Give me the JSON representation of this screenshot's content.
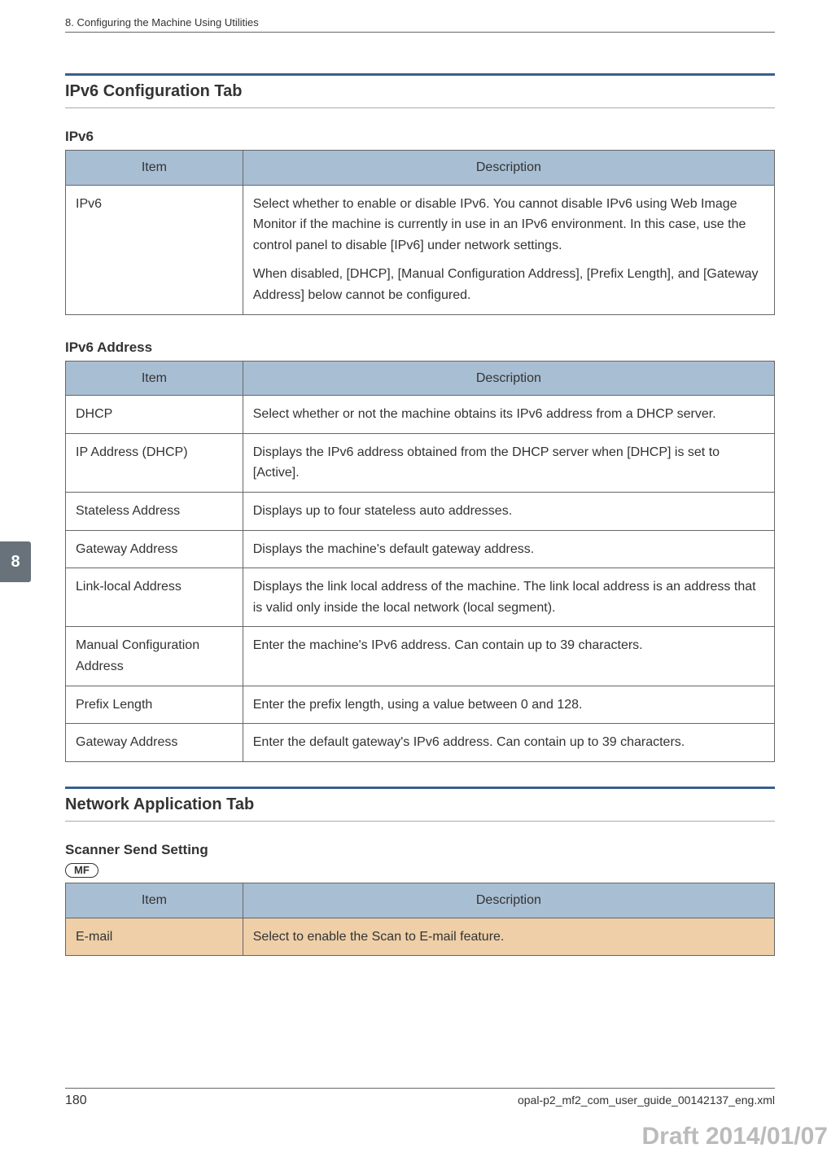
{
  "header": {
    "chapter": "8. Configuring the Machine Using Utilities"
  },
  "side_tab": "8",
  "section1": {
    "heading": "IPv6 Configuration Tab",
    "table1": {
      "title": "IPv6",
      "headers": {
        "item": "Item",
        "description": "Description"
      },
      "rows": [
        {
          "item": "IPv6",
          "desc1": "Select whether to enable or disable IPv6. You cannot disable IPv6 using Web Image Monitor if the machine is currently in use in an IPv6 environment. In this case, use the control panel to disable [IPv6] under network settings.",
          "desc2": "When disabled, [DHCP], [Manual Configuration Address], [Prefix Length], and [Gateway Address] below cannot be configured."
        }
      ]
    },
    "table2": {
      "title": "IPv6 Address",
      "headers": {
        "item": "Item",
        "description": "Description"
      },
      "rows": [
        {
          "item": "DHCP",
          "desc": "Select whether or not the machine obtains its IPv6 address from a DHCP server."
        },
        {
          "item": "IP Address (DHCP)",
          "desc": "Displays the IPv6 address obtained from the DHCP server when [DHCP] is set to [Active]."
        },
        {
          "item": "Stateless Address",
          "desc": "Displays up to four stateless auto addresses."
        },
        {
          "item": "Gateway Address",
          "desc": "Displays the machine's default gateway address."
        },
        {
          "item": "Link-local Address",
          "desc": "Displays the link local address of the machine. The link local address is an address that is valid only inside the local network (local segment)."
        },
        {
          "item": "Manual Configuration Address",
          "desc": "Enter the machine's IPv6 address. Can contain up to 39 characters."
        },
        {
          "item": "Prefix Length",
          "desc": "Enter the prefix length, using a value between 0 and 128."
        },
        {
          "item": "Gateway Address",
          "desc": "Enter the default gateway's IPv6 address. Can contain up to 39 characters."
        }
      ]
    }
  },
  "section2": {
    "heading": "Network Application Tab",
    "scanner_title": "Scanner Send Setting",
    "badge": "MF",
    "table": {
      "headers": {
        "item": "Item",
        "description": "Description"
      },
      "rows": [
        {
          "item": "E-mail",
          "desc": "Select to enable the Scan to E-mail feature."
        }
      ]
    }
  },
  "footer": {
    "page": "180",
    "file": "opal-p2_mf2_com_user_guide_00142137_eng.xml",
    "draft": "Draft 2014/01/07"
  }
}
